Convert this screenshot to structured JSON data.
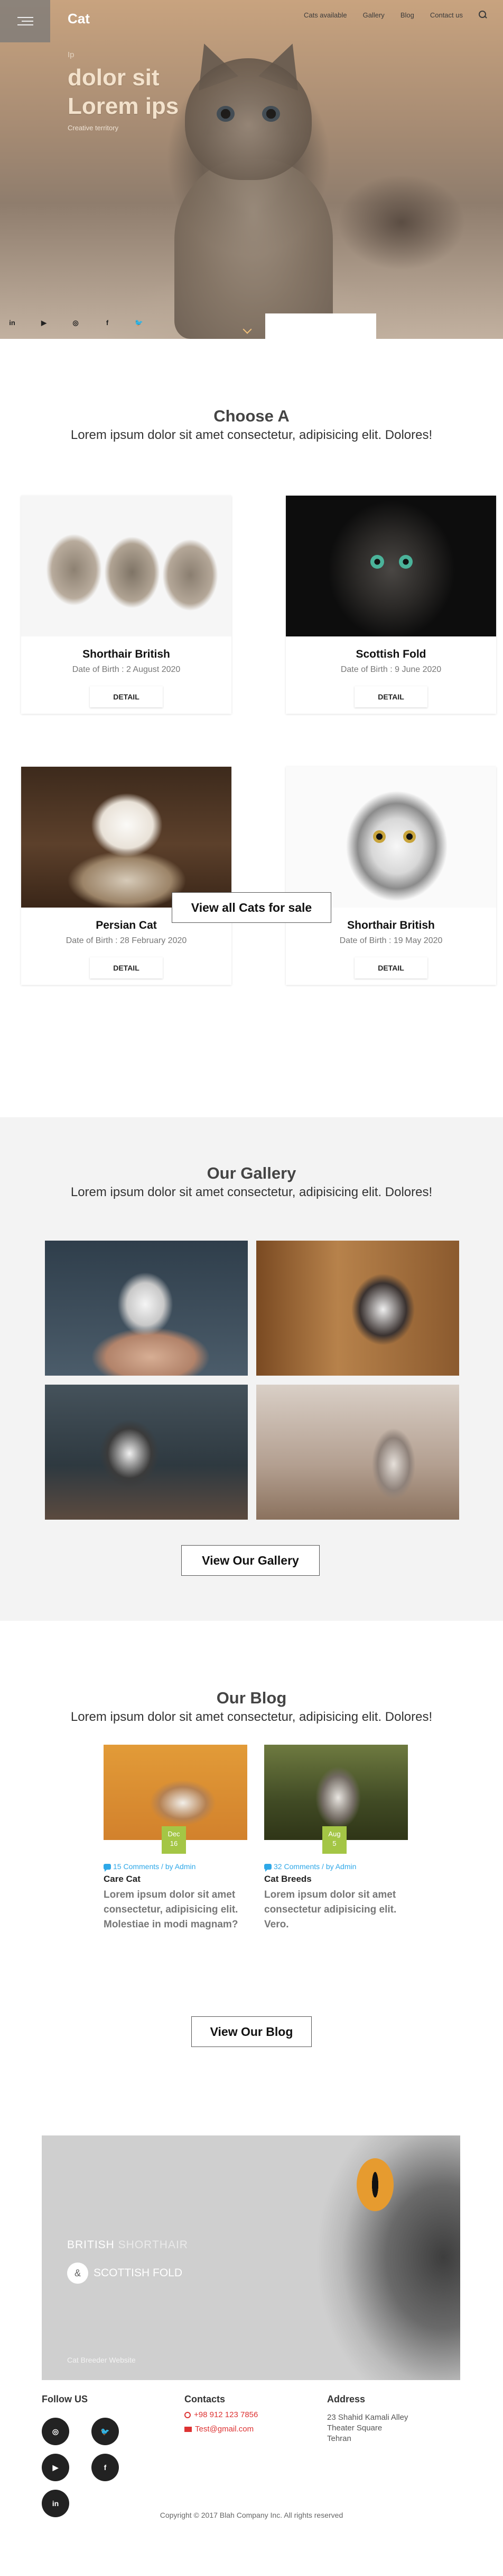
{
  "header": {
    "brand": "Cat",
    "nav": [
      "Cats available",
      "Gallery",
      "Blog",
      "Contact us"
    ],
    "kicker": "Ip",
    "title_line1": "dolor sit",
    "title_line2": "Lorem ips",
    "subtitle": "Creative territory",
    "social_icons": [
      "in",
      "▶",
      "◎",
      "f",
      "🐦"
    ]
  },
  "choose": {
    "title": "Choose A",
    "subtitle": "Lorem ipsum dolor sit amet consectetur, adipisicing elit. Dolores!",
    "cards": [
      {
        "name": "Shorthair British",
        "dob": "Date of Birth : 2 August 2020",
        "button": "DETAIL"
      },
      {
        "name": "Scottish Fold",
        "dob": "Date of Birth : 9 June 2020",
        "button": "DETAIL"
      },
      {
        "name": "Persian Cat",
        "dob": "Date of Birth : 28 February 2020",
        "button": "DETAIL"
      },
      {
        "name": "Shorthair British",
        "dob": "Date of Birth : 19 May 2020",
        "button": "DETAIL"
      }
    ],
    "view_all": "View all Cats for sale"
  },
  "gallery": {
    "title": "Our Gallery",
    "subtitle": "Lorem ipsum dolor sit amet consectetur, adipisicing elit. Dolores!",
    "button": "View Our Gallery"
  },
  "blog": {
    "title": "Our Blog",
    "subtitle": "Lorem ipsum dolor sit amet consectetur, adipisicing elit. Dolores!",
    "posts": [
      {
        "day_month": "Dec",
        "day": "16",
        "meta": "15 Comments / by Admin",
        "title": "Care Cat",
        "excerpt": "Lorem ipsum dolor sit amet consectetur, adipisicing elit. Molestiae in modi magnam?"
      },
      {
        "day_month": "Aug",
        "day": "5",
        "meta": "32 Comments / by Admin",
        "title": "Cat Breeds",
        "excerpt": "Lorem ipsum dolor sit amet consectetur adipisicing elit. Vero."
      }
    ],
    "button": "View Our Blog"
  },
  "promo": {
    "line1_a": "BRITISH",
    "line1_b": " SHORTHAIR",
    "amp": "&",
    "line2_a": "SCOTTISH",
    "line2_b": " FOLD",
    "caption": "Cat Breeder Website"
  },
  "footer": {
    "follow_title": "Follow US",
    "contacts_title": "Contacts",
    "phone": "+98 912 123 7856",
    "email": "Test@gmail.com",
    "address_title": "Address",
    "address_lines": [
      "23 Shahid Kamali Alley",
      "Theater Square",
      "Tehran"
    ],
    "social": [
      "◎",
      "🐦",
      "▶",
      "f",
      "in"
    ],
    "copyright": "Copyright © 2017 Blah Company Inc. All rights reserved"
  }
}
